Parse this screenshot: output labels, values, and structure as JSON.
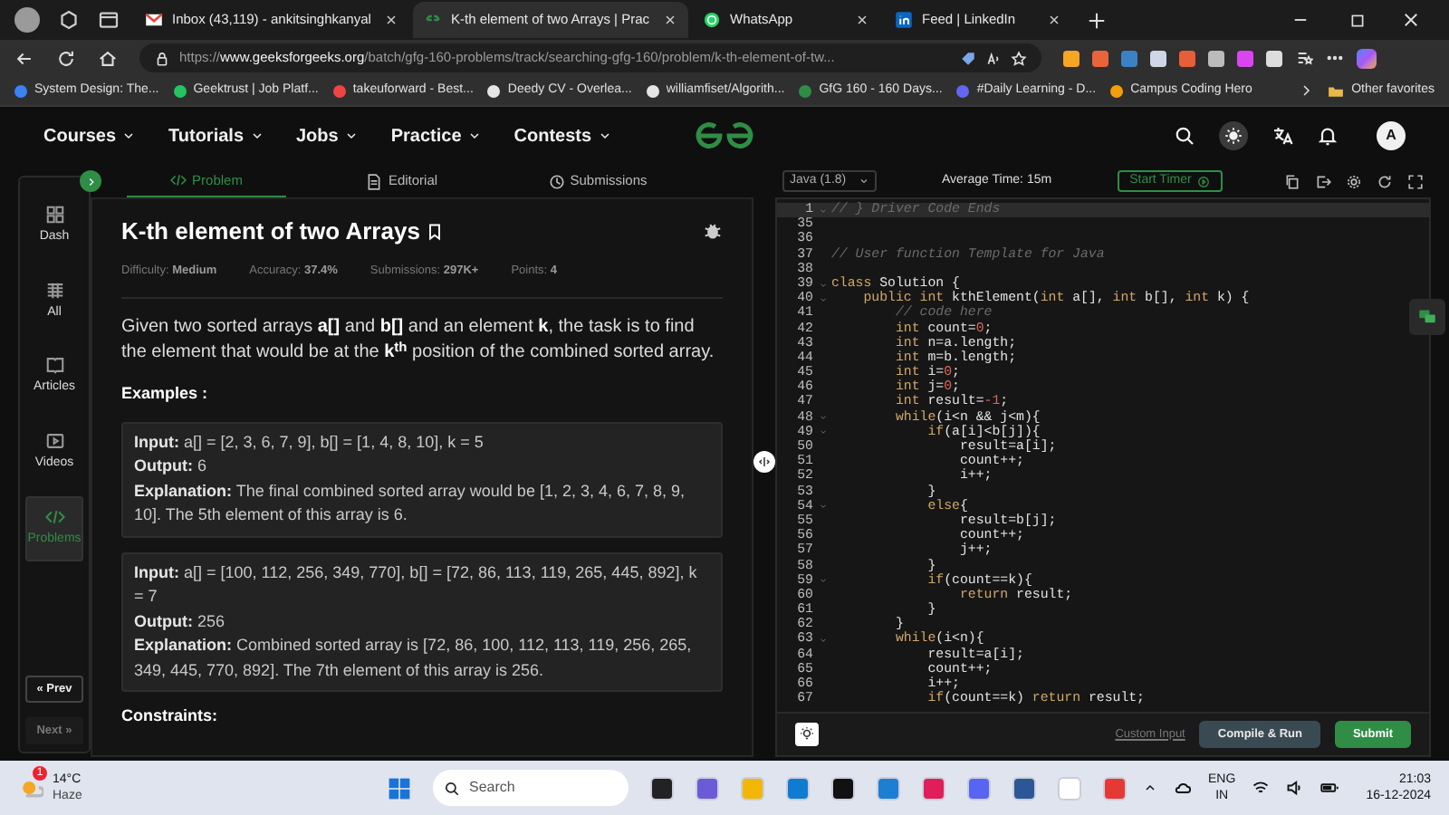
{
  "browser": {
    "tabs": [
      {
        "kind": "mail",
        "title": "Inbox (43,119) - ankitsinghkanyal",
        "selected": false
      },
      {
        "kind": "gfg",
        "title": "K-th element of two Arrays | Prac",
        "selected": true
      },
      {
        "kind": "chat",
        "title": "WhatsApp",
        "selected": false
      },
      {
        "kind": "network",
        "title": "Feed | LinkedIn",
        "selected": false
      }
    ],
    "address_prefix": "https://",
    "address_host": "www.geeksforgeeks.org",
    "address_path": "/batch/gfg-160-problems/track/searching-gfg-160/problem/k-th-element-of-tw...",
    "bookmarks": [
      "System Design: The...",
      "Geektrust | Job Platf...",
      "takeuforward - Best...",
      "Deedy CV - Overlea...",
      "williamfiset/Algorith...",
      "GfG 160 - 160 Days...",
      "#Daily Learning - D...",
      "Campus Coding Hero"
    ],
    "other_favorites": "Other favorites"
  },
  "site": {
    "nav": [
      "Courses",
      "Tutorials",
      "Jobs",
      "Practice",
      "Contests"
    ],
    "avatar": "A"
  },
  "sidebar": {
    "items": [
      {
        "label": "Dash",
        "selected": false
      },
      {
        "label": "All",
        "selected": false
      },
      {
        "label": "Articles",
        "selected": false
      },
      {
        "label": "Videos",
        "selected": false
      },
      {
        "label": "Problems",
        "selected": true
      }
    ],
    "pager": [
      {
        "label": "« Prev",
        "disabled": false
      },
      {
        "label": "Next »",
        "disabled": true
      }
    ]
  },
  "problem": {
    "tabs": [
      {
        "label": "Problem",
        "selected": true
      },
      {
        "label": "Editorial",
        "selected": false
      },
      {
        "label": "Submissions",
        "selected": false
      }
    ],
    "title": "K-th element of two Arrays",
    "meta": [
      {
        "label": "Difficulty:",
        "value": "Medium"
      },
      {
        "label": "Accuracy:",
        "value": "37.4%"
      },
      {
        "label": "Submissions:",
        "value": "297K+"
      },
      {
        "label": "Points:",
        "value": "4"
      }
    ],
    "description": "Given two sorted arrays **a[]** and **b[]** and an element **k**, the task is to find the element that would be at the **k**$^{th}$ position of the combined sorted array.",
    "examples_heading": "Examples :",
    "examples": [
      {
        "lines": [
          {
            "label": "Input:",
            "text": "a[] = [2, 3, 6, 7, 9], b[] = [1, 4, 8, 10], k = 5"
          },
          {
            "label": "Output:",
            "text": "6"
          },
          {
            "label": "Explanation:",
            "text": "The final combined sorted array would be [1, 2, 3, 4, 6, 7, 8, 9, 10]. The 5th element of this array is 6."
          }
        ]
      },
      {
        "lines": [
          {
            "label": "Input:",
            "text": "a[] = [100, 112, 256, 349, 770], b[] = [72, 86, 113, 119, 265, 445, 892], k = 7"
          },
          {
            "label": "Output:",
            "text": "256"
          },
          {
            "label": "Explanation:",
            "text": "Combined sorted array is [72, 86, 100, 112, 113, 119, 256, 265, 349, 445, 770, 892]. The 7th element of this array is 256."
          }
        ]
      }
    ],
    "constraints_heading": "Constraints:"
  },
  "editor": {
    "language": "Java (1.8)",
    "average_time": "Average Time: 15m",
    "start_timer": "Start Timer",
    "lines": [
      {
        "number": "1",
        "fold": true,
        "highlighted": true,
        "code": [
          {
            "kind": "comment",
            "text": "// } Driver Code Ends"
          }
        ]
      },
      {
        "number": "35",
        "fold": false,
        "highlighted": false
      },
      {
        "number": "36",
        "fold": false,
        "highlighted": false
      },
      {
        "number": "37",
        "fold": false,
        "highlighted": false,
        "code": [
          {
            "kind": "comment",
            "text": "// User function Template for Java"
          }
        ]
      },
      {
        "number": "38",
        "fold": false,
        "highlighted": false
      },
      {
        "number": "39",
        "fold": true,
        "highlighted": false,
        "code": [
          {
            "kind": "keyword",
            "text": "class"
          },
          {
            "kind": "plain",
            "text": " Solution {"
          }
        ]
      },
      {
        "number": "40",
        "fold": true,
        "highlighted": false,
        "code": [
          {
            "kind": "keyword",
            "text": "    public int"
          },
          {
            "kind": "plain",
            "text": " kthElement("
          },
          {
            "kind": "keyword",
            "text": "int"
          },
          {
            "kind": "plain",
            "text": " a[], "
          },
          {
            "kind": "keyword",
            "text": "int"
          },
          {
            "kind": "plain",
            "text": " b[], "
          },
          {
            "kind": "keyword",
            "text": "int"
          },
          {
            "kind": "plain",
            "text": " k) {"
          }
        ]
      },
      {
        "number": "41",
        "fold": false,
        "highlighted": false,
        "code": [
          {
            "kind": "comment",
            "text": "        // code here"
          }
        ]
      },
      {
        "number": "42",
        "fold": false,
        "highlighted": false,
        "code": [
          {
            "kind": "keyword",
            "text": "        int"
          },
          {
            "kind": "plain",
            "text": " count="
          },
          {
            "kind": "number",
            "text": "0"
          },
          {
            "kind": "plain",
            "text": ";"
          }
        ]
      },
      {
        "number": "43",
        "fold": false,
        "highlighted": false,
        "code": [
          {
            "kind": "keyword",
            "text": "        int"
          },
          {
            "kind": "plain",
            "text": " n=a.length;"
          }
        ]
      },
      {
        "number": "44",
        "fold": false,
        "highlighted": false,
        "code": [
          {
            "kind": "keyword",
            "text": "        int"
          },
          {
            "kind": "plain",
            "text": " m=b.length;"
          }
        ]
      },
      {
        "number": "45",
        "fold": false,
        "highlighted": false,
        "code": [
          {
            "kind": "keyword",
            "text": "        int"
          },
          {
            "kind": "plain",
            "text": " i="
          },
          {
            "kind": "number",
            "text": "0"
          },
          {
            "kind": "plain",
            "text": ";"
          }
        ]
      },
      {
        "number": "46",
        "fold": false,
        "highlighted": false,
        "code": [
          {
            "kind": "keyword",
            "text": "        int"
          },
          {
            "kind": "plain",
            "text": " j="
          },
          {
            "kind": "number",
            "text": "0"
          },
          {
            "kind": "plain",
            "text": ";"
          }
        ]
      },
      {
        "number": "47",
        "fold": false,
        "highlighted": false,
        "code": [
          {
            "kind": "keyword",
            "text": "        int"
          },
          {
            "kind": "plain",
            "text": " result="
          },
          {
            "kind": "number",
            "text": "-1"
          },
          {
            "kind": "plain",
            "text": ";"
          }
        ]
      },
      {
        "number": "48",
        "fold": true,
        "highlighted": false,
        "code": [
          {
            "kind": "keyword",
            "text": "        while"
          },
          {
            "kind": "plain",
            "text": "(i<n && j<m){"
          }
        ]
      },
      {
        "number": "49",
        "fold": true,
        "highlighted": false,
        "code": [
          {
            "kind": "keyword",
            "text": "            if"
          },
          {
            "kind": "plain",
            "text": "(a[i]<b[j]){"
          }
        ]
      },
      {
        "number": "50",
        "fold": false,
        "highlighted": false,
        "code": [
          {
            "kind": "plain",
            "text": "                result=a[i];"
          }
        ]
      },
      {
        "number": "51",
        "fold": false,
        "highlighted": false,
        "code": [
          {
            "kind": "plain",
            "text": "                count++;"
          }
        ]
      },
      {
        "number": "52",
        "fold": false,
        "highlighted": false,
        "code": [
          {
            "kind": "plain",
            "text": "                i++;"
          }
        ]
      },
      {
        "number": "53",
        "fold": false,
        "highlighted": false,
        "code": [
          {
            "kind": "plain",
            "text": "            }"
          }
        ]
      },
      {
        "number": "54",
        "fold": true,
        "highlighted": false,
        "code": [
          {
            "kind": "keyword",
            "text": "            else"
          },
          {
            "kind": "plain",
            "text": "{"
          }
        ]
      },
      {
        "number": "55",
        "fold": false,
        "highlighted": false,
        "code": [
          {
            "kind": "plain",
            "text": "                result=b[j];"
          }
        ]
      },
      {
        "number": "56",
        "fold": false,
        "highlighted": false,
        "code": [
          {
            "kind": "plain",
            "text": "                count++;"
          }
        ]
      },
      {
        "number": "57",
        "fold": false,
        "highlighted": false,
        "code": [
          {
            "kind": "plain",
            "text": "                j++;"
          }
        ]
      },
      {
        "number": "58",
        "fold": false,
        "highlighted": false,
        "code": [
          {
            "kind": "plain",
            "text": "            }"
          }
        ]
      },
      {
        "number": "59",
        "fold": true,
        "highlighted": false,
        "code": [
          {
            "kind": "keyword",
            "text": "            if"
          },
          {
            "kind": "plain",
            "text": "(count==k){"
          }
        ]
      },
      {
        "number": "60",
        "fold": false,
        "highlighted": false,
        "code": [
          {
            "kind": "keyword",
            "text": "                return"
          },
          {
            "kind": "plain",
            "text": " result;"
          }
        ]
      },
      {
        "number": "61",
        "fold": false,
        "highlighted": false,
        "code": [
          {
            "kind": "plain",
            "text": "            }"
          }
        ]
      },
      {
        "number": "62",
        "fold": false,
        "highlighted": false,
        "code": [
          {
            "kind": "plain",
            "text": "        }"
          }
        ]
      },
      {
        "number": "63",
        "fold": true,
        "highlighted": false,
        "code": [
          {
            "kind": "keyword",
            "text": "        while"
          },
          {
            "kind": "plain",
            "text": "(i<n){"
          }
        ]
      },
      {
        "number": "64",
        "fold": false,
        "highlighted": false,
        "code": [
          {
            "kind": "plain",
            "text": "            result=a[i];"
          }
        ]
      },
      {
        "number": "65",
        "fold": false,
        "highlighted": false,
        "code": [
          {
            "kind": "plain",
            "text": "            count++;"
          }
        ]
      },
      {
        "number": "66",
        "fold": false,
        "highlighted": false,
        "code": [
          {
            "kind": "plain",
            "text": "            i++;"
          }
        ]
      },
      {
        "number": "67",
        "fold": false,
        "highlighted": false,
        "code": [
          {
            "kind": "keyword",
            "text": "            if"
          },
          {
            "kind": "plain",
            "text": "(count==k) "
          },
          {
            "kind": "keyword",
            "text": "return"
          },
          {
            "kind": "plain",
            "text": " result;"
          }
        ]
      }
    ],
    "custom_input": "Custom Input",
    "buttons": [
      {
        "label": "Compile & Run",
        "kind": "secondary"
      },
      {
        "label": "Submit",
        "kind": "primary"
      }
    ]
  },
  "taskbar": {
    "temperature": "14°C",
    "condition": "Haze",
    "badge": "1",
    "search_placeholder": "Search",
    "language": "ENG",
    "region": "IN",
    "time": "21:03",
    "date": "16-12-2024"
  }
}
